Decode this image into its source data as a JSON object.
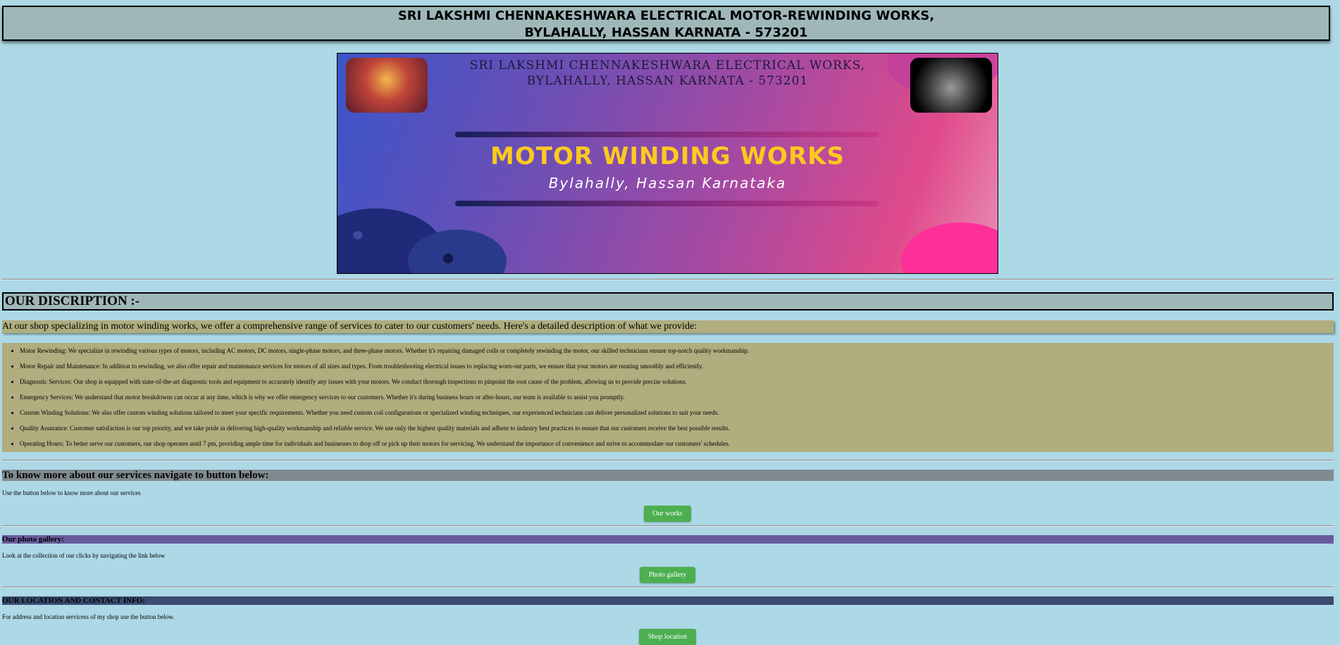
{
  "header": {
    "line1": "SRI LAKSHMI CHENNAKESHWARA ELECTRICAL MOTOR-REWINDING WORKS,",
    "line2": "BYLAHALLY, HASSAN KARNATA - 573201"
  },
  "banner": {
    "top_line1": "SRI LAKSHMI CHENNAKESHWARA ELECTRICAL WORKS,",
    "top_line2": "BYLAHALLY, HASSAN KARNATA - 573201",
    "headline": "MOTOR WINDING WORKS",
    "subline": "Bylahally, Hassan Karnataka"
  },
  "description": {
    "heading": "OUR DISCRIPTION :-",
    "intro": "At our shop specializing in motor winding works, we offer a comprehensive range of services to cater to our customers' needs. Here's a detailed description of what we provide:",
    "items": [
      "Motor Rewinding: We specialize in rewinding various types of motors, including AC motors, DC motors, single-phase motors, and three-phase motors. Whether it's repairing damaged coils or completely rewinding the motor, our skilled technicians ensure top-notch quality workmanship.",
      "Motor Repair and Maintenance: In addition to rewinding, we also offer repair and maintenance services for motors of all sizes and types. From troubleshooting electrical issues to replacing worn-out parts, we ensure that your motors are running smoothly and efficiently.",
      "Diagnostic Services: Our shop is equipped with state-of-the-art diagnostic tools and equipment to accurately identify any issues with your motors. We conduct thorough inspections to pinpoint the root cause of the problem, allowing us to provide precise solutions.",
      "Emergency Services: We understand that motor breakdowns can occur at any time, which is why we offer emergency services to our customers. Whether it's during business hours or after-hours, our team is available to assist you promptly.",
      "Custom Winding Solutions: We also offer custom winding solutions tailored to meet your specific requirements. Whether you need custom coil configurations or specialized winding techniques, our experienced technicians can deliver personalized solutions to suit your needs.",
      "Quality Assurance: Customer satisfaction is our top priority, and we take pride in delivering high-quality workmanship and reliable service. We use only the highest quality materials and adhere to industry best practices to ensure that our customers receive the best possible results.",
      "Operating Hours: To better serve our customers, our shop operates until 7 pm, providing ample time for individuals and businesses to drop off or pick up their motors for servicing. We understand the importance of convenience and strive to accommodate our customers' schedules."
    ]
  },
  "services": {
    "heading": "To know more about our services navigate to button below:",
    "text": "Use the button below to know more about our services",
    "button": "Our works"
  },
  "gallery": {
    "heading": "Our photo gallery:",
    "text": "Look at the collection of our clicks by navigating the link below",
    "button": "Photo gallery"
  },
  "location": {
    "heading": "OUR LOCATION AND CONTACT INFO:",
    "text": "For address and location servicess of my shop use the button below.",
    "button": "Shop location"
  },
  "colors": {
    "page_bg": "#add8e6",
    "title_bg": "#9fb7b9",
    "description_bg": "#b0ad7e",
    "services_band": "#808a8f",
    "gallery_band": "#6a5c9c",
    "location_band": "#3a4a70",
    "button_green": "#4caf50",
    "banner_headline": "#ffc91f"
  }
}
